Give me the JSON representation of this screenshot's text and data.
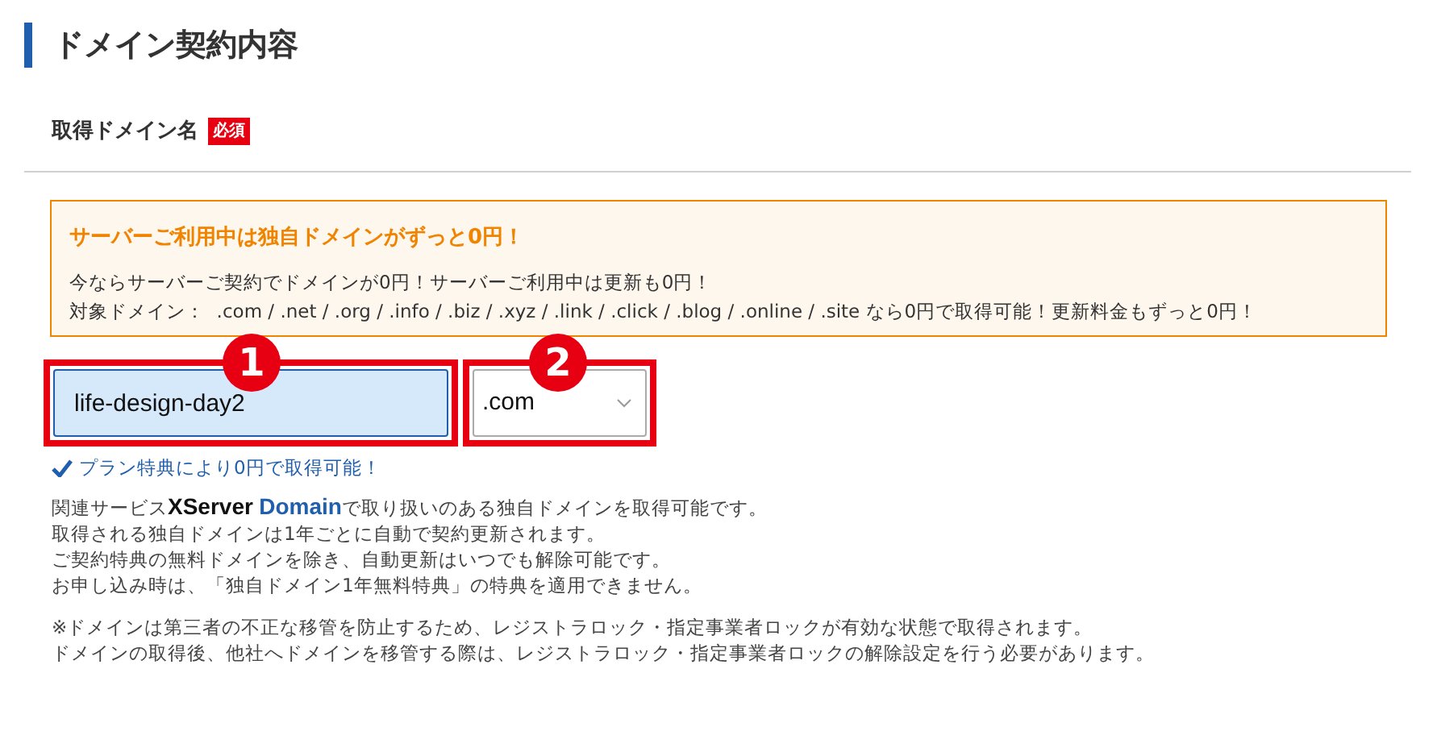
{
  "section_title": "ドメイン契約内容",
  "field_label": "取得ドメイン名",
  "required_badge": "必須",
  "notice": {
    "title": "サーバーご利用中は独自ドメインがずっと0円！",
    "lines": [
      "今ならサーバーご契約でドメインが0円！サーバーご利用中は更新も0円！",
      "対象ドメイン：  .com / .net / .org / .info / .biz / .xyz / .link / .click / .blog / .online / .site なら0円で取得可能！更新料金もずっと0円！"
    ]
  },
  "domain_input": {
    "value": "life-design-day2"
  },
  "tld_select": {
    "value": ".com"
  },
  "markers": [
    "1",
    "2"
  ],
  "status": "プラン特典により0円で取得可能！",
  "service_note": {
    "before": "関連サービス",
    "brand_1": "XServer",
    "brand_2": "Domain",
    "after": "で取り扱いのある独自ドメインを取得可能です。"
  },
  "notes": [
    "取得される独自ドメインは1年ごとに自動で契約更新されます。",
    "ご契約特典の無料ドメインを除き、自動更新はいつでも解除可能です。",
    "お申し込み時は、「独自ドメイン1年無料特典」の特典を適用できません。"
  ],
  "cautions": [
    "※ドメインは第三者の不正な移管を防止するため、レジストラロック・指定事業者ロックが有効な状態で取得されます。",
    "ドメインの取得後、他社へドメインを移管する際は、レジストラロック・指定事業者ロックの解除設定を行う必要があります。"
  ]
}
